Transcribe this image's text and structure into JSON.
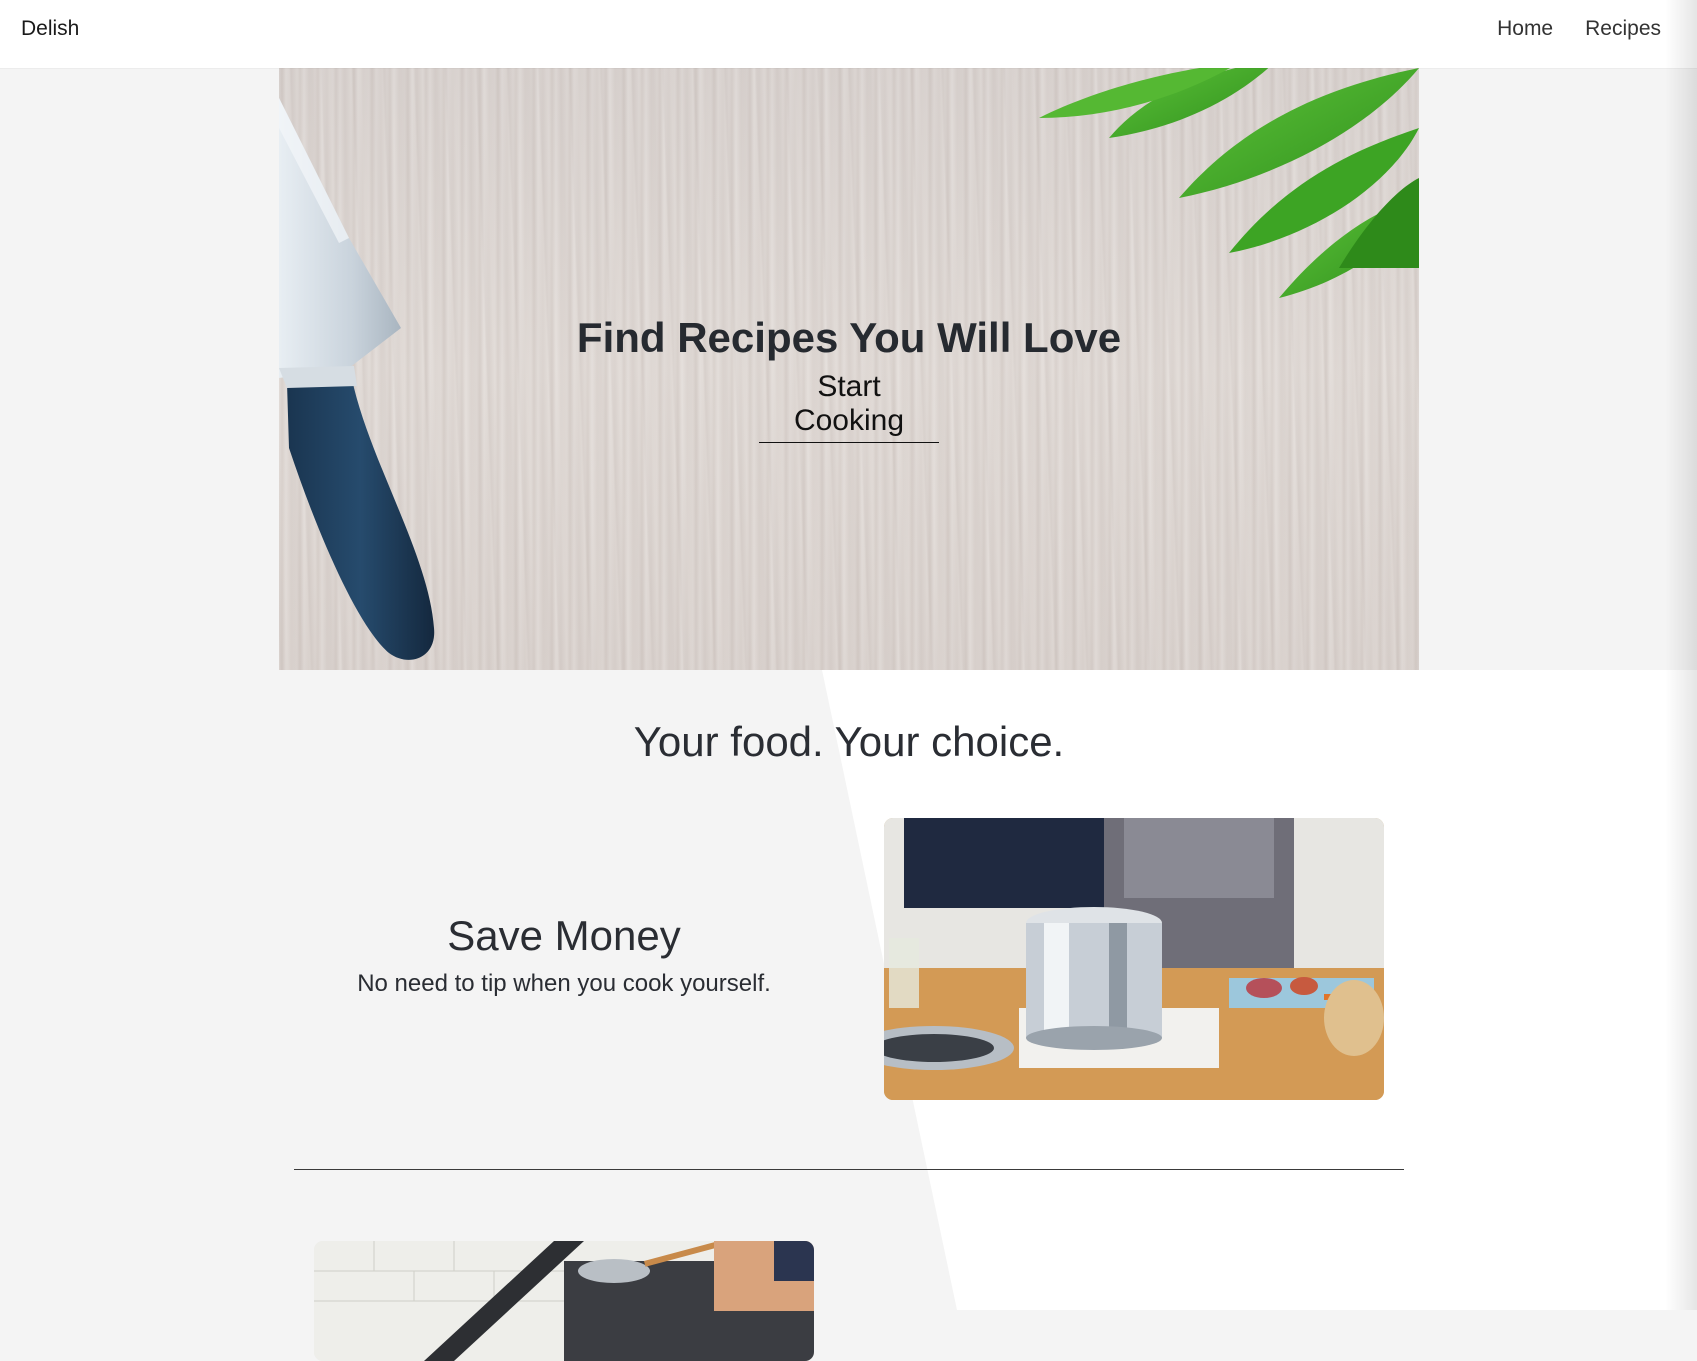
{
  "navbar": {
    "brand": "Delish",
    "links": [
      "Home",
      "Recipes"
    ]
  },
  "hero": {
    "title": "Find Recipes You Will Love",
    "cta": "Start Cooking"
  },
  "tagline": "Your food. Your choice.",
  "features": [
    {
      "title": "Save Money",
      "description": "No need to tip when you cook yourself."
    }
  ],
  "colors": {
    "page_bg": "#f4f4f4",
    "text": "#22262b",
    "navbar_bg": "#ffffff"
  }
}
